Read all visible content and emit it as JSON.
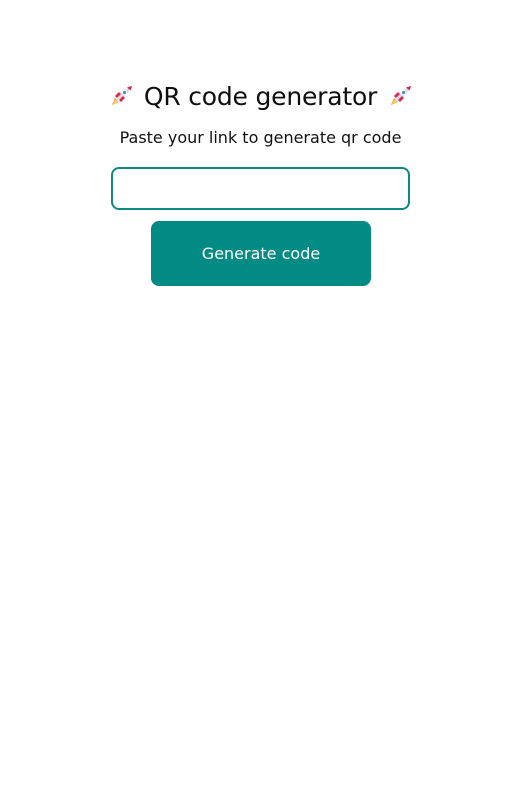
{
  "header": {
    "title": "QR code generator",
    "left_icon": "rocket-icon",
    "right_icon": "rocket-icon"
  },
  "form": {
    "prompt": "Paste your link to generate qr code",
    "link_input": {
      "value": "",
      "placeholder": ""
    },
    "generate_label": "Generate code"
  },
  "colors": {
    "accent": "#028a84",
    "input_border": "#0f8883",
    "text": "#111111",
    "background": "#ffffff"
  }
}
